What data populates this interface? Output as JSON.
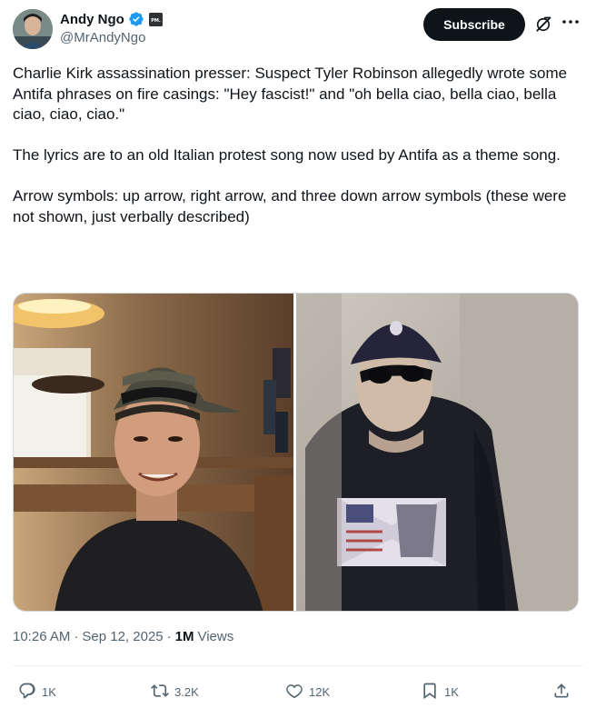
{
  "author": {
    "display_name": "Andy Ngo",
    "handle": "@MrAndyNgo",
    "avatar_icon": "avatar-photo",
    "verified_icon": "verified-badge-icon",
    "affiliate_badge_text": "PM."
  },
  "header_actions": {
    "subscribe_label": "Subscribe",
    "grok_icon": "grok-icon",
    "more_icon": "more-options-icon"
  },
  "tweet": {
    "text": "Charlie Kirk assassination presser: Suspect Tyler Robinson allegedly wrote some Antifa phrases on fire casings: \"Hey fascist!\" and \"oh bella ciao, bella ciao, bella ciao, ciao, ciao.\"\n\nThe lyrics are to an old Italian protest song now used by Antifa as a theme song.\n\nArrow symbols: up arrow, right arrow, and three down arrow symbols (these were not shown, just verbally described)"
  },
  "media": {
    "images": [
      "photo-smiling-man-cap",
      "photo-surveillance-man-cap"
    ]
  },
  "meta": {
    "time": "10:26 AM",
    "date": "Sep 12, 2025",
    "separator": "·",
    "views_count": "1M",
    "views_label": "Views"
  },
  "actions": {
    "reply_count": "1K",
    "repost_count": "3.2K",
    "like_count": "12K",
    "bookmark_count": "1K",
    "share_icon": "share-icon"
  },
  "colors": {
    "text_primary": "#0f1419",
    "text_secondary": "#536471",
    "verified_blue": "#1d9bf0",
    "button_dark": "#0f1419",
    "divider": "#eff3f4"
  }
}
